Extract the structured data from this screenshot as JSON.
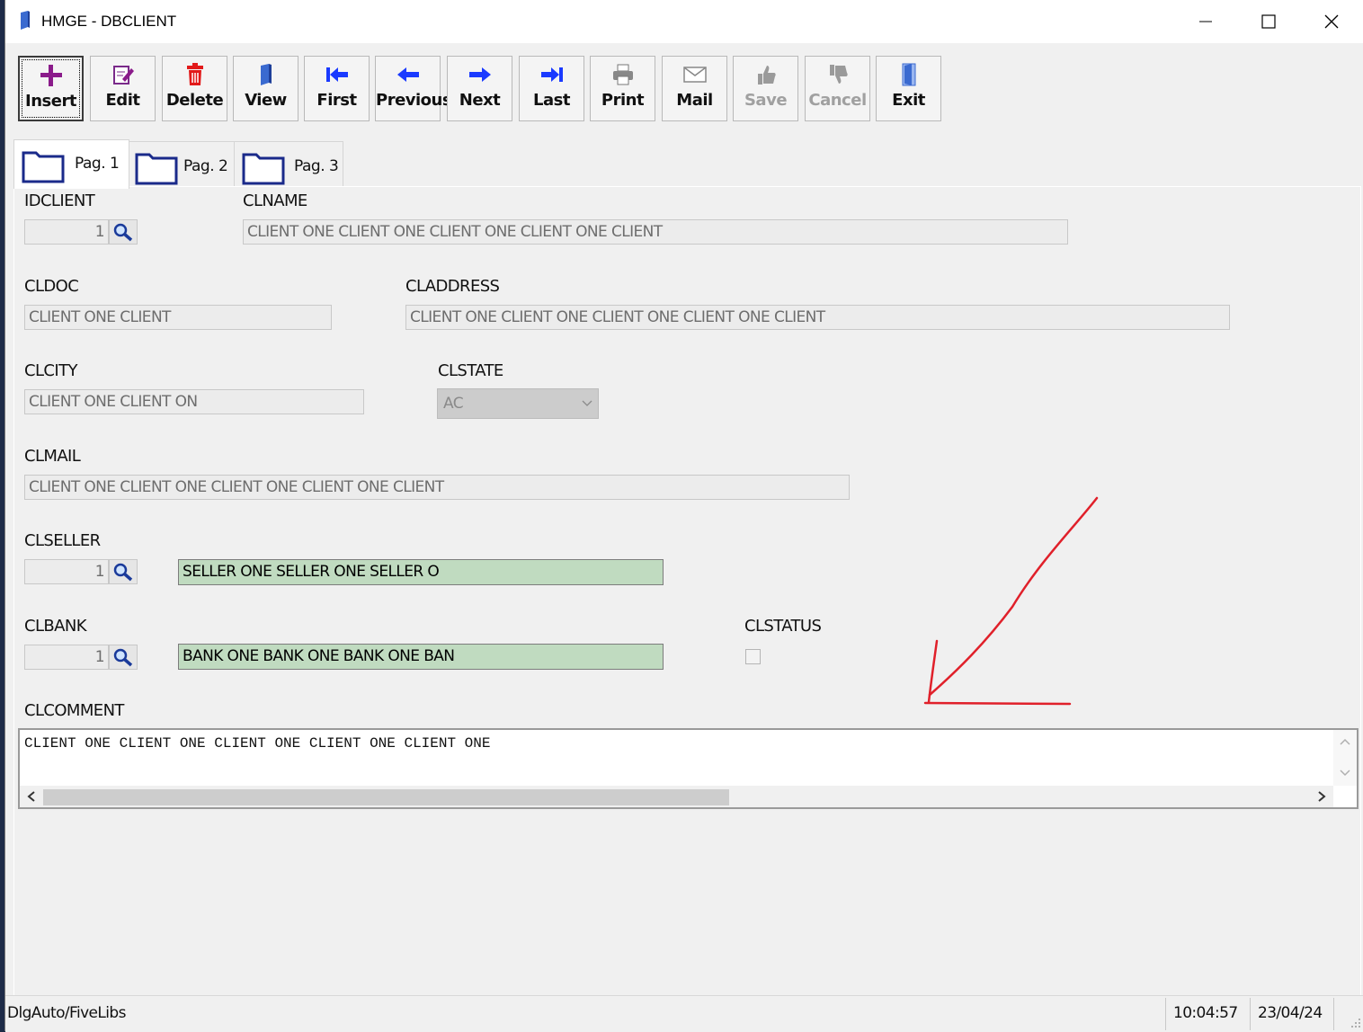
{
  "window": {
    "title": "HMGE - DBCLIENT"
  },
  "toolbar": {
    "insert": "Insert",
    "edit": "Edit",
    "delete": "Delete",
    "view": "View",
    "first": "First",
    "previous": "Previous",
    "next": "Next",
    "last": "Last",
    "print": "Print",
    "mail": "Mail",
    "save": "Save",
    "cancel": "Cancel",
    "exit": "Exit"
  },
  "tabs": [
    {
      "label": "Pag. 1",
      "selected": true
    },
    {
      "label": "Pag. 2",
      "selected": false
    },
    {
      "label": "Pag. 3",
      "selected": false
    }
  ],
  "form": {
    "idclient": {
      "label": "IDCLIENT",
      "value": "1"
    },
    "clname": {
      "label": "CLNAME",
      "value": "CLIENT ONE CLIENT ONE CLIENT ONE CLIENT ONE CLIENT"
    },
    "cldoc": {
      "label": "CLDOC",
      "value": "CLIENT ONE CLIENT"
    },
    "claddress": {
      "label": "CLADDRESS",
      "value": "CLIENT ONE CLIENT ONE CLIENT ONE CLIENT ONE CLIENT"
    },
    "clcity": {
      "label": "CLCITY",
      "value": "CLIENT ONE CLIENT ON"
    },
    "clstate": {
      "label": "CLSTATE",
      "value": "AC"
    },
    "clmail": {
      "label": "CLMAIL",
      "value": "CLIENT ONE CLIENT ONE CLIENT ONE CLIENT ONE CLIENT"
    },
    "clseller": {
      "label": "CLSELLER",
      "value": "1",
      "description": "SELLER ONE SELLER ONE SELLER O"
    },
    "clbank": {
      "label": "CLBANK",
      "value": "1",
      "description": "BANK ONE BANK ONE BANK ONE BAN"
    },
    "clstatus": {
      "label": "CLSTATUS",
      "checked": false
    },
    "clcomment": {
      "label": "CLCOMMENT",
      "value": "CLIENT ONE CLIENT ONE CLIENT ONE CLIENT ONE CLIENT ONE"
    }
  },
  "status": {
    "left": "DlgAuto/FiveLibs",
    "time": "10:04:57",
    "date": "23/04/24"
  },
  "colors": {
    "annotation": "#e0202a",
    "lookup_bg": "#c0dbc0",
    "tab_folder": "#1a2a8a"
  }
}
